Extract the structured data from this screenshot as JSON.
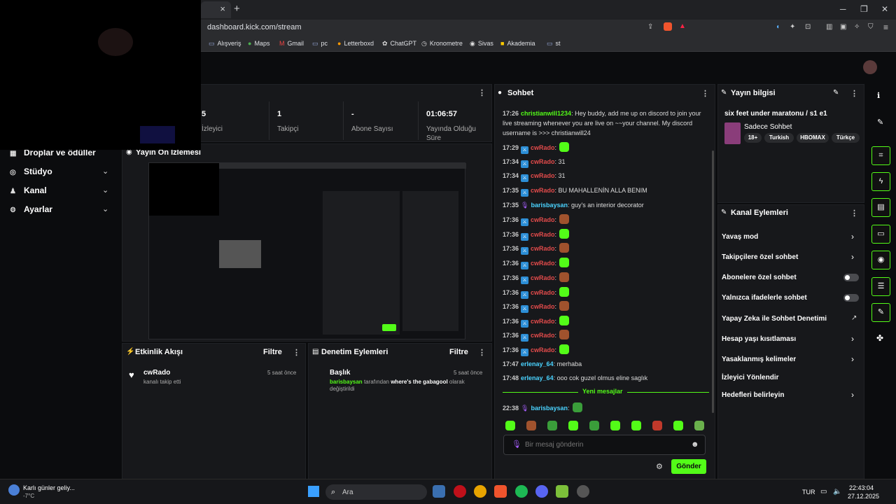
{
  "browser": {
    "close_tab": "×",
    "new_tab": "+",
    "url": "dashboard.kick.com/stream",
    "bookmarks": [
      "Alışveriş",
      "Maps",
      "Gmail",
      "pc",
      "Letterboxd",
      "ChatGPT",
      "Kronometre",
      "Sivas",
      "Akademia",
      "st"
    ]
  },
  "sidebar": {
    "items": [
      {
        "label": "Droplar ve ödüller"
      },
      {
        "label": "Stüdyo"
      },
      {
        "label": "Kanal"
      },
      {
        "label": "Ayarlar"
      }
    ]
  },
  "stats": {
    "viewers": {
      "value": "5",
      "label": "İzleyici"
    },
    "followers": {
      "value": "1",
      "label": "Takipçi"
    },
    "subs": {
      "value": "-",
      "label": "Abone Sayısı"
    },
    "uptime": {
      "value": "01:06:57",
      "label": "Yayında Olduğu Süre"
    }
  },
  "preview": {
    "title": "Yayın Ön İzlemesi"
  },
  "activity": {
    "title": "Etkinlik Akışı",
    "filter": "Filtre",
    "item": {
      "user": "cwRado",
      "text": "kanalı takip etti",
      "time": "5 saat önce"
    }
  },
  "moderation": {
    "title": "Denetim Eylemleri",
    "filter": "Filtre",
    "item": {
      "title": "Başlık",
      "user": "barisbaysan",
      "mid": "tarafından",
      "value": "where's the gabagool",
      "end": "olarak değiştirildi",
      "time": "5 saat önce"
    }
  },
  "chat": {
    "title": "Sohbet",
    "messages": [
      {
        "time": "17:26",
        "user": "christianwill1234",
        "text": ": Hey buddy, add me up on discord to join your live streaming whenever you are live on ~~your channel. My discord username is >>> christianwill24"
      },
      {
        "time": "17:29",
        "user": "cwRado",
        "text": ":"
      },
      {
        "time": "17:34",
        "user": "cwRado",
        "text": ": 31"
      },
      {
        "time": "17:34",
        "user": "cwRado",
        "text": ": 31"
      },
      {
        "time": "17:35",
        "user": "cwRado",
        "text": ": BU MAHALLENİN ALLA BENIM"
      },
      {
        "time": "17:35",
        "user": "barisbaysan",
        "text": ": guy's an interior decorator"
      },
      {
        "time": "17:36",
        "user": "cwRado",
        "text": ":"
      },
      {
        "time": "17:36",
        "user": "cwRado",
        "text": ":"
      },
      {
        "time": "17:36",
        "user": "cwRado",
        "text": ":"
      },
      {
        "time": "17:36",
        "user": "cwRado",
        "text": ":"
      },
      {
        "time": "17:36",
        "user": "cwRado",
        "text": ":"
      },
      {
        "time": "17:36",
        "user": "cwRado",
        "text": ":"
      },
      {
        "time": "17:36",
        "user": "cwRado",
        "text": ":"
      },
      {
        "time": "17:36",
        "user": "cwRado",
        "text": ":"
      },
      {
        "time": "17:36",
        "user": "cwRado",
        "text": ":"
      },
      {
        "time": "17:36",
        "user": "cwRado",
        "text": ":"
      },
      {
        "time": "17:47",
        "user": "erlenay_64",
        "text": ": merhaba"
      },
      {
        "time": "17:48",
        "user": "erlenay_64",
        "text": ": ooo cok guzel olmus eline saglık"
      },
      {
        "time": "22:38",
        "user": "barisbaysan",
        "text": ":"
      }
    ],
    "new_messages": "Yeni mesajlar",
    "placeholder": "Bir mesaj gönderin",
    "send": "Gönder"
  },
  "stream_info": {
    "title": "Yayın bilgisi",
    "stream_title": "six feet under maratonu / s1 e1",
    "category": "Sadece Sohbet",
    "tags": [
      "18+",
      "Turkish",
      "HBOMAX",
      "Türkçe"
    ]
  },
  "channel_actions": {
    "title": "Kanal Eylemleri",
    "items": [
      {
        "label": "Yavaş mod"
      },
      {
        "label": "Takipçilere özel sohbet"
      },
      {
        "label": "Abonelere özel sohbet"
      },
      {
        "label": "Yalnızca ifadelerle sohbet"
      },
      {
        "label": "Yapay Zeka ile Sohbet Denetimi"
      },
      {
        "label": "Hesap yaşı kısıtlaması"
      },
      {
        "label": "Yasaklanmış kelimeler"
      },
      {
        "label": "İzleyici Yönlendir"
      },
      {
        "label": "Hedefleri belirleyin"
      }
    ]
  },
  "taskbar": {
    "weather_title": "Karlı günler geliy...",
    "weather_temp": "-7°C",
    "search": "Ara",
    "lang": "TUR",
    "time": "22:43:04",
    "date": "27.12.2025"
  },
  "colors": {
    "accent": "#53fc18",
    "mod_user": "#e34b4b",
    "sub_user": "#4ad3ff"
  }
}
